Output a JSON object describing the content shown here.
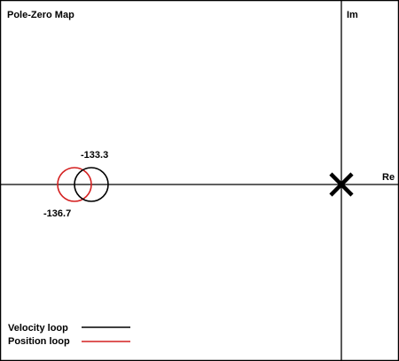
{
  "title": "Pole-Zero Map",
  "axes": {
    "imag_label": "Im",
    "real_label": "Re"
  },
  "markers": [
    {
      "kind": "zero",
      "loop": "velocity",
      "label": "-133.3"
    },
    {
      "kind": "zero",
      "loop": "position",
      "label": "-136.7"
    },
    {
      "kind": "pole",
      "loop": "both",
      "label": ""
    }
  ],
  "legend": {
    "velocity": {
      "label": "Velocity loop",
      "color": "#000000"
    },
    "position": {
      "label": "Position loop",
      "color": "#d42020"
    }
  },
  "colors": {
    "frame": "#000000",
    "axis": "#000000",
    "pole": "#000000"
  }
}
